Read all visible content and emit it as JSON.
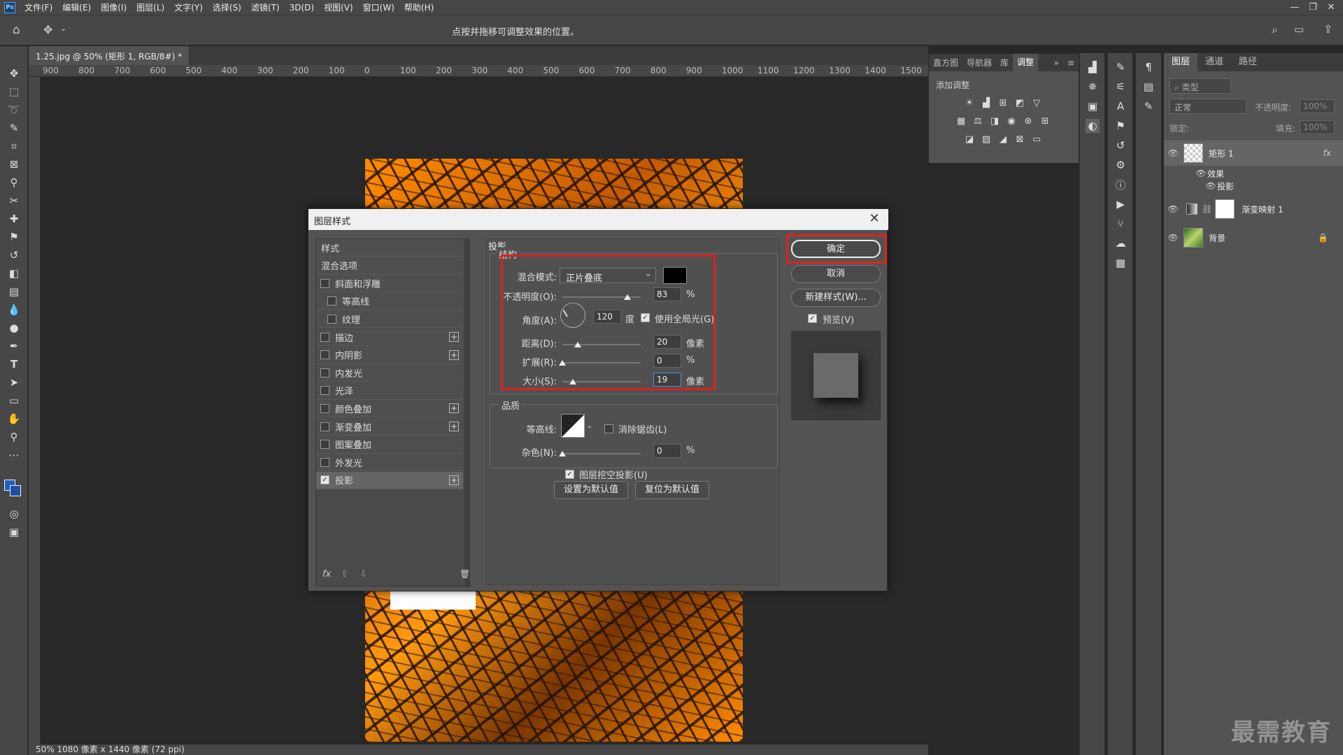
{
  "menubar": {
    "logo": "Ps",
    "items": [
      "文件(F)",
      "编辑(E)",
      "图像(I)",
      "图层(L)",
      "文字(Y)",
      "选择(S)",
      "滤镜(T)",
      "3D(D)",
      "视图(V)",
      "窗口(W)",
      "帮助(H)"
    ]
  },
  "options_bar": {
    "hint": "点按并拖移可调整效果的位置。"
  },
  "document": {
    "tab": "1.25.jpg @ 50% (矩形 1, RGB/8#) *",
    "status": "50%    1080 像素 x 1440 像素 (72 ppi)"
  },
  "ruler_labels": [
    "900",
    "800",
    "700",
    "600",
    "500",
    "400",
    "300",
    "200",
    "100",
    "0",
    "100",
    "200",
    "300",
    "400",
    "500",
    "600",
    "700",
    "800",
    "900",
    "1000",
    "1100",
    "1200",
    "1300",
    "1400",
    "1500"
  ],
  "adjustments_panel": {
    "tabs": [
      "直方图",
      "导航器",
      "库",
      "调整"
    ],
    "active_tab": "调整",
    "label": "添加调整"
  },
  "layers_panel": {
    "tabs": [
      "图层",
      "通道",
      "路径"
    ],
    "filter_placeholder": "类型",
    "blend": "正常",
    "opacity_label": "不透明度:",
    "opacity": "100%",
    "lock_label": "锁定:",
    "fill_label": "填充:",
    "fill": "100%",
    "layers": [
      {
        "name": "矩形 1",
        "fx": "fx",
        "effects_label": "效果",
        "effect": "投影"
      },
      {
        "name": "渐变映射 1"
      },
      {
        "name": "背景"
      }
    ]
  },
  "dialog": {
    "title": "图层样式",
    "close": "✕",
    "style_list": [
      {
        "label": "样式",
        "type": "header"
      },
      {
        "label": "混合选项",
        "type": "header"
      },
      {
        "label": "斜面和浮雕",
        "checked": false
      },
      {
        "label": "等高线",
        "checked": false,
        "indent": true
      },
      {
        "label": "纹理",
        "checked": false,
        "indent": true
      },
      {
        "label": "描边",
        "checked": false,
        "plus": true
      },
      {
        "label": "内阴影",
        "checked": false,
        "plus": true
      },
      {
        "label": "内发光",
        "checked": false
      },
      {
        "label": "光泽",
        "checked": false
      },
      {
        "label": "颜色叠加",
        "checked": false,
        "plus": true
      },
      {
        "label": "渐变叠加",
        "checked": false,
        "plus": true
      },
      {
        "label": "图案叠加",
        "checked": false
      },
      {
        "label": "外发光",
        "checked": false
      },
      {
        "label": "投影",
        "checked": true,
        "plus": true,
        "selected": true
      }
    ],
    "list_footer": {
      "fx": "fx",
      "up": "⇧",
      "down": "⇩",
      "delete": "🗑"
    },
    "section_title": "投影",
    "structure": {
      "title": "结构",
      "blend_mode_label": "混合模式:",
      "blend_mode": "正片叠底",
      "shadow_color": "#000000",
      "opacity_label": "不透明度(O):",
      "opacity": "83",
      "opacity_unit": "%",
      "opacity_fraction": 0.83,
      "angle_label": "角度(A):",
      "angle": "120",
      "angle_unit": "度",
      "global_light_label": "使用全局光(G)",
      "global_light": true,
      "distance_label": "距离(D):",
      "distance": "20",
      "distance_unit": "像素",
      "distance_fraction": 0.2,
      "spread_label": "扩展(R):",
      "spread": "0",
      "spread_unit": "%",
      "spread_fraction": 0.0,
      "size_label": "大小(S):",
      "size": "19",
      "size_unit": "像素",
      "size_fraction": 0.13
    },
    "quality": {
      "title": "品质",
      "contour_label": "等高线:",
      "antialias_label": "消除锯齿(L)",
      "antialias": false,
      "noise_label": "杂色(N):",
      "noise": "0",
      "noise_unit": "%",
      "noise_fraction": 0.0
    },
    "knockout_label": "图层挖空投影(U)",
    "knockout": true,
    "set_default": "设置为默认值",
    "reset_default": "复位为默认值",
    "ok": "确定",
    "cancel": "取消",
    "new_style": "新建样式(W)...",
    "preview_label": "预览(V)",
    "preview": true
  },
  "watermark": "最需教育",
  "colors": {
    "highlight": "#e02020",
    "photo": "#ff8c00"
  }
}
